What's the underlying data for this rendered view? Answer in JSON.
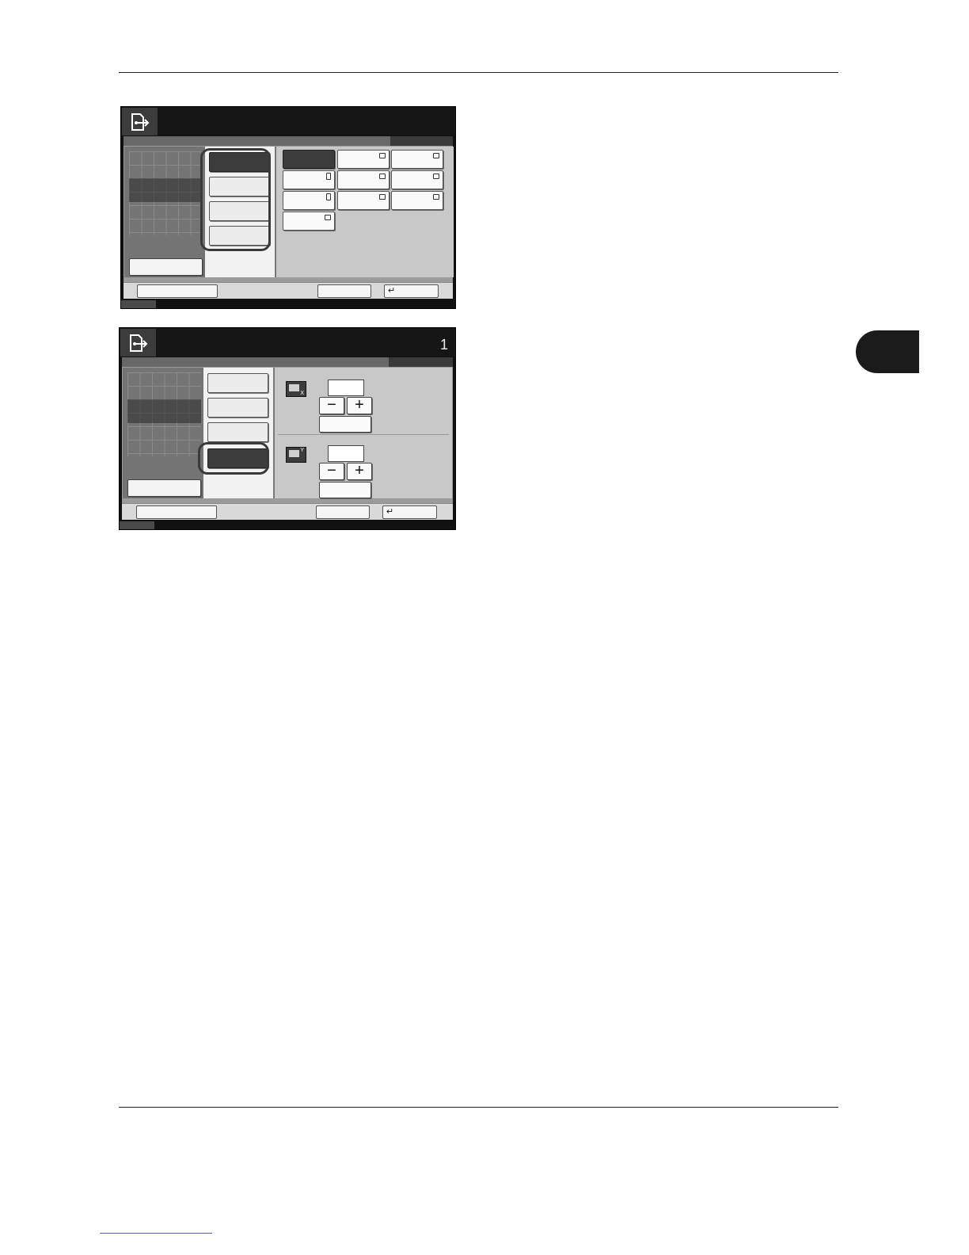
{
  "page": {
    "chapter_tab_color": "#1b1b1b",
    "rule_color": "#222222",
    "link_underline_color": "#4a5fd0"
  },
  "screen1": {
    "title": "",
    "home_icon": "copy-output-icon",
    "left_button": "",
    "paper_options": [
      "",
      "",
      "",
      ""
    ],
    "selected_option_index": 0,
    "paper_keys": [
      {
        "label": "",
        "icon": "none",
        "selected": true
      },
      {
        "label": "",
        "icon": "landscape-paper-icon"
      },
      {
        "label": "",
        "icon": "landscape-paper-icon"
      },
      {
        "label": "",
        "icon": "portrait-paper-icon"
      },
      {
        "label": "",
        "icon": "landscape-paper-icon"
      },
      {
        "label": "",
        "icon": "landscape-paper-icon"
      },
      {
        "label": "",
        "icon": "portrait-paper-icon"
      },
      {
        "label": "",
        "icon": "landscape-paper-icon"
      },
      {
        "label": "",
        "icon": "landscape-paper-icon"
      },
      {
        "label": "",
        "icon": "landscape-paper-icon"
      }
    ],
    "footer": {
      "left": "",
      "cancel": "",
      "ok": "",
      "ok_icon": "return-arrow-icon",
      "return_glyph": "↵"
    }
  },
  "screen2": {
    "title": "",
    "copies": "1",
    "home_icon": "copy-output-icon",
    "left_button": "",
    "options": [
      "",
      "",
      "",
      ""
    ],
    "selected_option_index": 3,
    "x_axis": {
      "icon_label": "X",
      "value": "",
      "minus": "−",
      "plus": "+",
      "key": ""
    },
    "y_axis": {
      "icon_label": "Y",
      "value": "",
      "minus": "−",
      "plus": "+",
      "key": ""
    },
    "footer": {
      "left": "",
      "cancel": "",
      "ok": "",
      "ok_icon": "return-arrow-icon",
      "return_glyph": "↵"
    }
  }
}
